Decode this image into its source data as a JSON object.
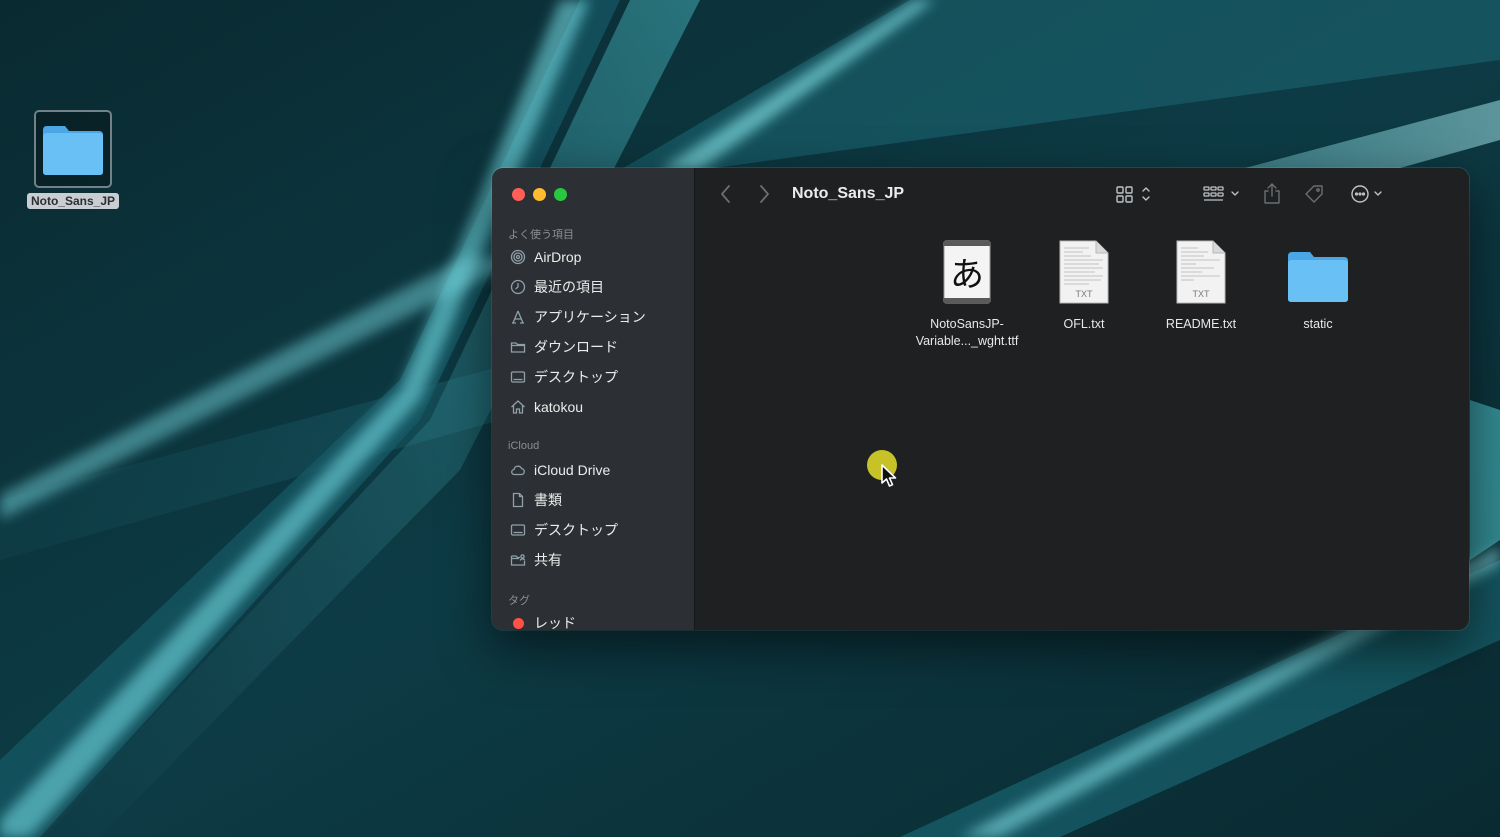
{
  "desktop": {
    "folder_label": "Noto_Sans_JP"
  },
  "window": {
    "title": "Noto_Sans_JP"
  },
  "sidebar": {
    "favorites_header": "よく使う項目",
    "favorites": [
      {
        "label": "AirDrop",
        "icon": "airdrop-icon"
      },
      {
        "label": "最近の項目",
        "icon": "clock-icon"
      },
      {
        "label": "アプリケーション",
        "icon": "applications-icon"
      },
      {
        "label": "ダウンロード",
        "icon": "folder-icon"
      },
      {
        "label": "デスクトップ",
        "icon": "desktop-icon"
      },
      {
        "label": "katokou",
        "icon": "home-icon"
      }
    ],
    "icloud_header": "iCloud",
    "icloud": [
      {
        "label": "iCloud Drive",
        "icon": "cloud-icon"
      },
      {
        "label": "書類",
        "icon": "document-icon"
      },
      {
        "label": "デスクトップ",
        "icon": "desktop-icon"
      },
      {
        "label": "共有",
        "icon": "shared-folder-icon"
      }
    ],
    "tags_header": "タグ",
    "tags": [
      {
        "label": "レッド",
        "color": "#ff5147"
      }
    ]
  },
  "files": [
    {
      "name": "NotoSansJP-Variable..._wght.ttf",
      "kind": "font",
      "glyph": "あ"
    },
    {
      "name": "OFL.txt",
      "kind": "txt",
      "badge": "TXT"
    },
    {
      "name": "README.txt",
      "kind": "txt",
      "badge": "TXT"
    },
    {
      "name": "static",
      "kind": "folder"
    }
  ]
}
